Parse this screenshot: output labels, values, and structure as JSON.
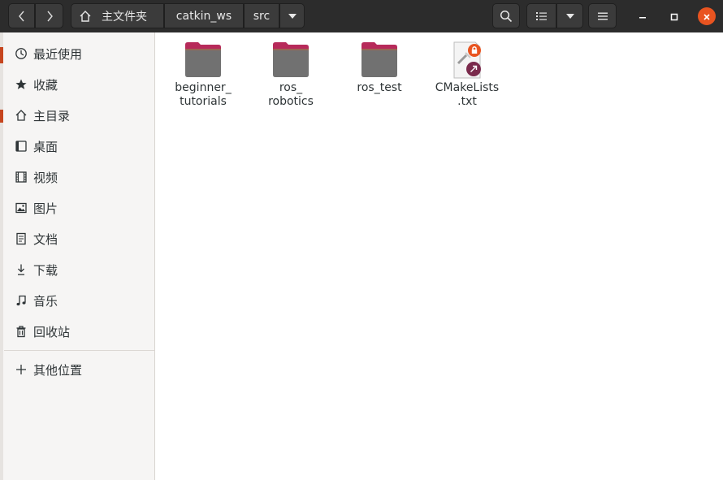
{
  "header": {
    "back_icon": "chevron-left-icon",
    "forward_icon": "chevron-right-icon",
    "breadcrumb": [
      {
        "label": "主文件夹",
        "icon": "home-icon"
      },
      {
        "label": "catkin_ws"
      },
      {
        "label": "src"
      }
    ],
    "search_icon": "search-icon",
    "view_icon": "list-view-icon",
    "menu_icon": "hamburger-menu-icon",
    "window_controls": [
      "minimize",
      "maximize",
      "close"
    ]
  },
  "sidebar": {
    "items": [
      {
        "label": "最近使用",
        "icon": "recent-icon"
      },
      {
        "label": "收藏",
        "icon": "star-icon"
      },
      {
        "label": "主目录",
        "icon": "home-icon"
      },
      {
        "label": "桌面",
        "icon": "desktop-icon"
      },
      {
        "label": "视频",
        "icon": "video-icon"
      },
      {
        "label": "图片",
        "icon": "picture-icon"
      },
      {
        "label": "文档",
        "icon": "document-icon"
      },
      {
        "label": "下载",
        "icon": "download-icon"
      },
      {
        "label": "音乐",
        "icon": "music-icon"
      },
      {
        "label": "回收站",
        "icon": "trash-icon"
      }
    ],
    "other_locations": {
      "label": "其他位置",
      "icon": "plus-icon"
    }
  },
  "files": [
    {
      "name": "beginner_\ntutorials",
      "type": "folder"
    },
    {
      "name": "ros_\nrobotics",
      "type": "folder"
    },
    {
      "name": "ros_test",
      "type": "folder"
    },
    {
      "name": "CMakeLists\n.txt",
      "type": "symlink-locked-file"
    }
  ],
  "colors": {
    "headerbar": "#2c2c2c",
    "accent": "#e95420",
    "folder_body": "#717171",
    "folder_tab": "#b72a5a",
    "symlink_badge": "#7a2a4c"
  }
}
